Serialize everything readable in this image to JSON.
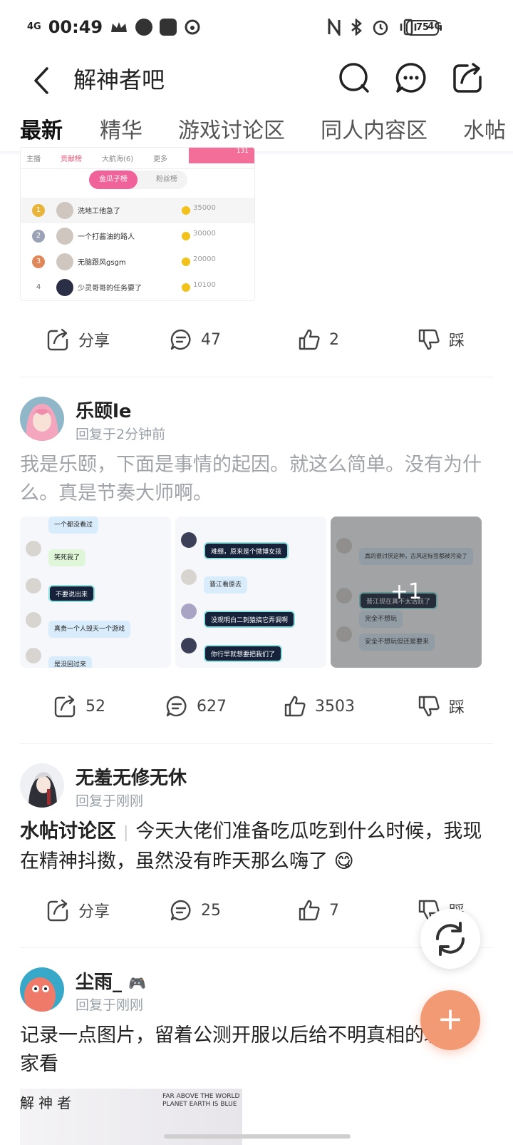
{
  "status": {
    "time": "00:49",
    "net": "4G",
    "battery": "75",
    "net2": "4G"
  },
  "header": {
    "title": "解神者吧"
  },
  "tabs": [
    "最新",
    "精华",
    "游戏讨论区",
    "同人内容区",
    "水帖"
  ],
  "rank_image": {
    "tabs": [
      "主播",
      "贡献榜",
      "大航海(6)",
      "更多"
    ],
    "pink_label": "131",
    "switch": [
      "金瓜子榜",
      "粉丝榜"
    ],
    "rows": [
      {
        "rank": "1",
        "name": "洗地工他急了",
        "value": "35000"
      },
      {
        "rank": "2",
        "name": "一个打酱油的路人",
        "value": "30000"
      },
      {
        "rank": "3",
        "name": "无脑跟风gsgm",
        "value": "20000"
      },
      {
        "rank": "4",
        "name": "少灵哥哥的任务要了",
        "value": "10100"
      }
    ]
  },
  "posts": [
    {
      "actions": {
        "share": "分享",
        "comments": "47",
        "likes": "2",
        "dislike": "踩"
      }
    },
    {
      "user": "乐颐le",
      "time": "回复于2分钟前",
      "text": "我是乐颐，下面是事情的起因。就这么简单。没有为什么。真是节奏大师啊。",
      "images": {
        "img1_bubbles": [
          "一个都没看过",
          "笑死我了",
          "不要说出来",
          "真贵一个人毁天一个游戏",
          "是没回过来"
        ],
        "img2_bubbles": [
          "难绷，原来是个微博女孩",
          "晋江看原去",
          "没观明白二刺猿搞它弄调啊",
          "你行早就想要把我们了"
        ],
        "img3_bubbles": [
          "真的很讨厌这种，古风这标签都被污染了",
          "晋江现在真不太活跃了",
          "完全不想玩",
          "安全不想玩但还是要来"
        ],
        "more": "+1"
      },
      "actions": {
        "share": "52",
        "comments": "627",
        "likes": "3503",
        "dislike": "踩"
      }
    },
    {
      "user": "无羞无修无休",
      "time": "回复于刚刚",
      "board": "水帖讨论区",
      "text": "今天大佬们准备吃瓜吃到什么时候，我现在精神抖擞，虽然没有昨天那么嗨了",
      "emoji": "😋",
      "actions": {
        "share": "分享",
        "comments": "25",
        "likes": "7",
        "dislike": "踩"
      }
    },
    {
      "user": "尘雨_",
      "badge": "🎮",
      "time": "回复于刚刚",
      "text": "记录一点图片，留着公测开服以后给不明真相的玩家看",
      "image_title": "解神者",
      "image_caption": "FAR ABOVE THE WORLD\nPLANET EARTH IS BLUE"
    }
  ],
  "fab": {
    "add": "+"
  },
  "colors": {
    "accent": "#e25a3a",
    "fab": "#f29a74",
    "pink": "#f0629a"
  }
}
